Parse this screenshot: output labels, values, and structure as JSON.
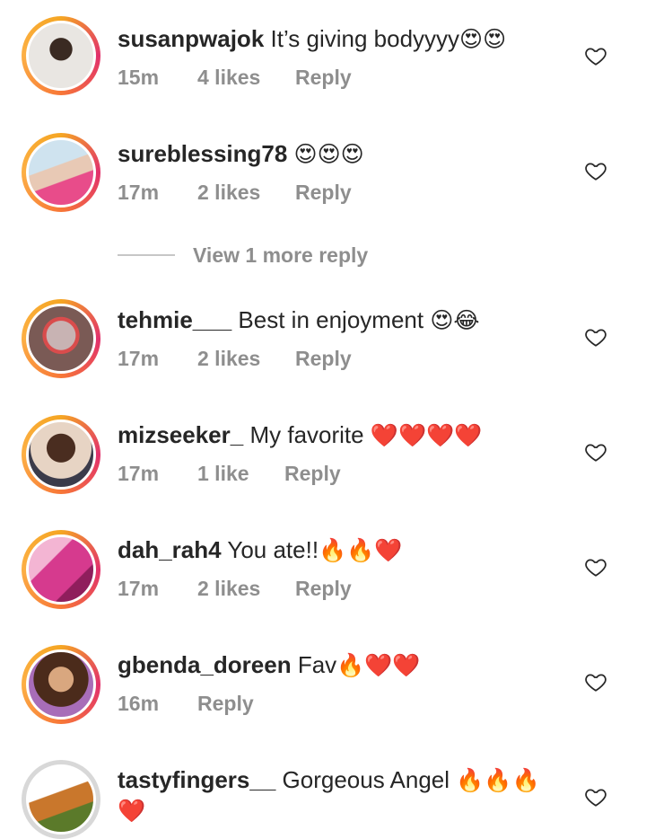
{
  "comments": [
    {
      "username": "susanpwajok",
      "text": "It’s giving bodyyyy",
      "emoji": "😍😍",
      "time": "15m",
      "likes": "4 likes",
      "reply": "Reply"
    },
    {
      "username": "sureblessing78",
      "text": "",
      "emoji": "😍😍😍",
      "time": "17m",
      "likes": "2 likes",
      "reply": "Reply"
    },
    {
      "username": "tehmie___",
      "text": "Best in enjoyment",
      "emoji": "😍😂",
      "time": "17m",
      "likes": "2 likes",
      "reply": "Reply"
    },
    {
      "username": "mizseeker_",
      "text": "My favorite",
      "emoji": "❤️❤️❤️❤️",
      "time": "17m",
      "likes": "1 like",
      "reply": "Reply"
    },
    {
      "username": "dah_rah4",
      "text": "You ate!!",
      "emoji": "🔥🔥❤️",
      "time": "17m",
      "likes": "2 likes",
      "reply": "Reply"
    },
    {
      "username": "gbenda_doreen",
      "text": "Fav",
      "emoji": "🔥❤️❤️",
      "time": "16m",
      "likes": "",
      "reply": "Reply"
    },
    {
      "username": "tastyfingers__",
      "text": "Gorgeous Angel",
      "emoji": "🔥🔥🔥",
      "emoji2": "❤️",
      "time": "",
      "likes": "",
      "reply": ""
    }
  ],
  "view_more_replies": "View 1 more reply",
  "icons": {
    "like": "heart-outline-icon"
  },
  "colors": {
    "username": "#262626",
    "meta": "#8e8e8e",
    "story_ring": "#e1306c"
  }
}
